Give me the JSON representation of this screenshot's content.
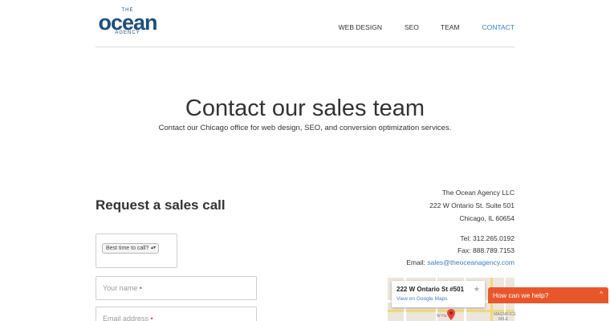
{
  "logo": {
    "top": "THE",
    "main": "ocean",
    "bottom": "AGENCY"
  },
  "nav": {
    "items": [
      {
        "label": "WEB DESIGN"
      },
      {
        "label": "SEO"
      },
      {
        "label": "TEAM"
      },
      {
        "label": "CONTACT",
        "active": true
      }
    ]
  },
  "hero": {
    "title": "Contact our sales team",
    "subtitle": "Contact our Chicago office for web design, SEO, and conversion optimization services."
  },
  "form": {
    "title": "Request a sales call",
    "best_time": {
      "selected": "Best time to call?"
    },
    "name": {
      "placeholder": "Your name",
      "required_mark": "•"
    },
    "email": {
      "placeholder": "Email address",
      "required_mark": "•"
    }
  },
  "address": {
    "company": "The Ocean Agency LLC",
    "street": "222 W Ontario St. Suite 501",
    "city": "Chicago, IL 60654"
  },
  "contact": {
    "tel": "Tel: 312.265.0192",
    "fax": "Fax: 888.789.7153",
    "email_label": "Email: ",
    "email": "sales@theoceanagency.com"
  },
  "map": {
    "card_address": "222 W Ontario St #501",
    "card_link": "View on Google Maps",
    "label_street": "W Hu",
    "label_mile": "MAGNIFICE MILE"
  },
  "chat": {
    "label": "How can we help?"
  },
  "colors": {
    "accent": "#3a7fc4",
    "logo": "#1f4e79",
    "chat": "#e8572c",
    "required": "#d9534f"
  }
}
